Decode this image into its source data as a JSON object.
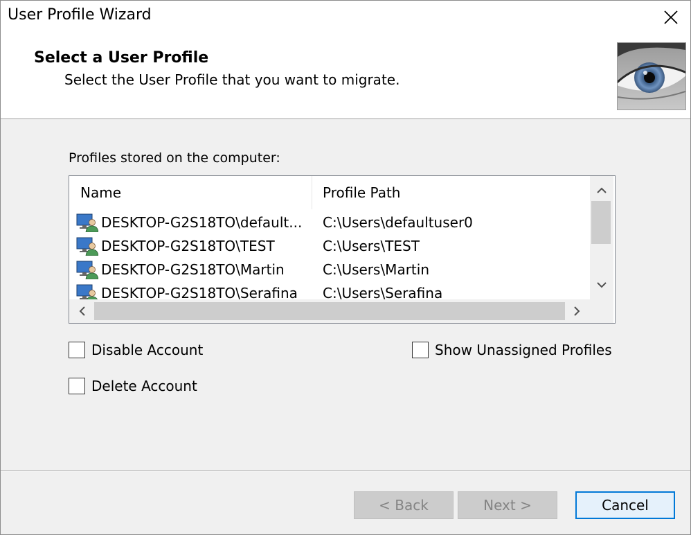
{
  "window": {
    "title": "User Profile Wizard"
  },
  "header": {
    "title": "Select a User Profile",
    "subtitle": "Select the User Profile that you want to migrate."
  },
  "profiles_label": "Profiles stored on the computer:",
  "table": {
    "columns": [
      "Name",
      "Profile Path"
    ],
    "rows": [
      {
        "name": "DESKTOP-G2S18TO\\default...",
        "path": "C:\\Users\\defaultuser0"
      },
      {
        "name": "DESKTOP-G2S18TO\\TEST",
        "path": "C:\\Users\\TEST"
      },
      {
        "name": "DESKTOP-G2S18TO\\Martin",
        "path": "C:\\Users\\Martin"
      },
      {
        "name": "DESKTOP-G2S18TO\\Serafina",
        "path": "C:\\Users\\Serafina"
      }
    ]
  },
  "options": {
    "disable_account": {
      "label": "Disable Account",
      "checked": false
    },
    "delete_account": {
      "label": "Delete Account",
      "checked": false
    },
    "show_unassigned": {
      "label": "Show Unassigned Profiles",
      "checked": false
    }
  },
  "buttons": {
    "back": "< Back",
    "next": "Next >",
    "cancel": "Cancel"
  },
  "icons": {
    "close": "close-icon",
    "user_profile": "user-profile-icon",
    "header_image": "eye-image",
    "scroll_up": "chevron-up-icon",
    "scroll_down": "chevron-down-icon",
    "scroll_left": "chevron-left-icon",
    "scroll_right": "chevron-right-icon"
  },
  "colors": {
    "accent": "#0078d7",
    "window_bg": "#f0f0f0",
    "header_bg": "#ffffff"
  }
}
